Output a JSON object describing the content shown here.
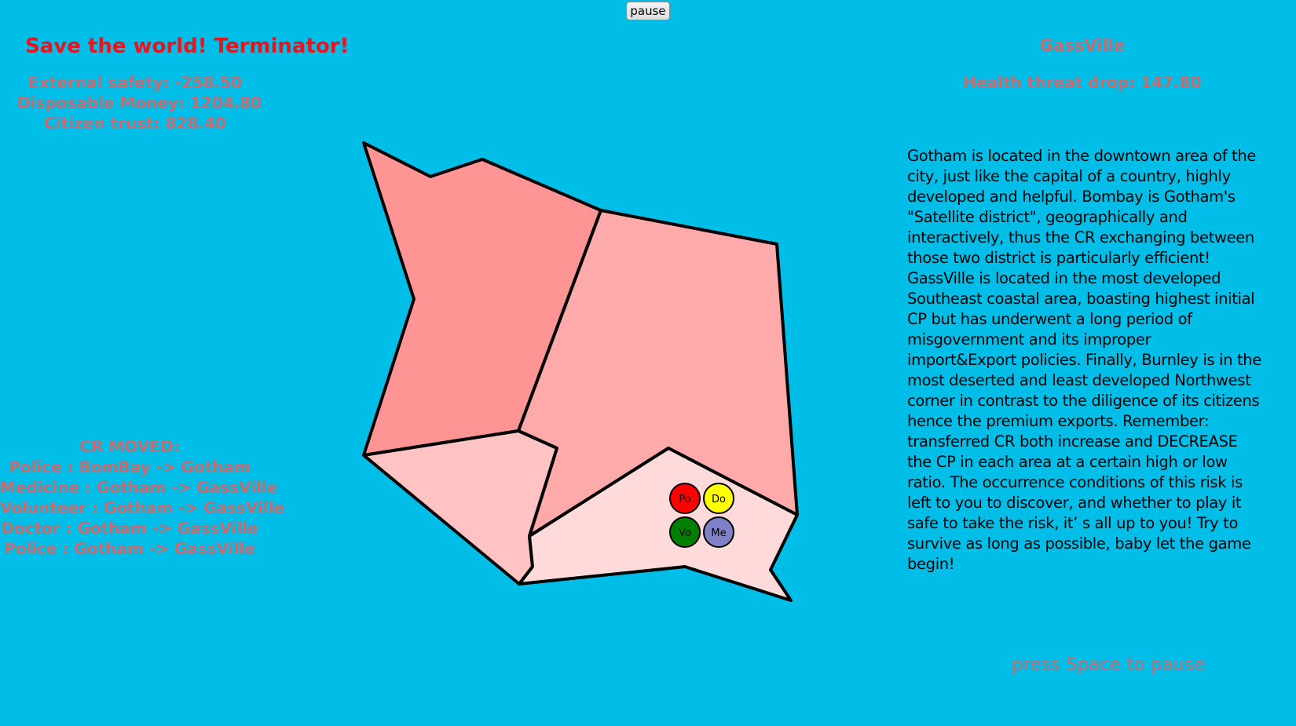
{
  "pause_button": "pause",
  "title": "Save the world! Terminator!",
  "stats": {
    "external_safety": "External safety: -258.50",
    "disposable_money": "Disposable Money: 1204.80",
    "citizen_trust": "Citizen trust: 828.40"
  },
  "selected_region": {
    "name": "GassVille",
    "health_threat": "Health threat drop: 147.80"
  },
  "cr_moved": {
    "title": "CR MOVED:",
    "items": [
      "Police : BomBay -> Gotham",
      "Medicine : Gotham -> GassVille",
      "Volunteer : Gotham -> GassVille",
      "Doctor : Gotham -> GassVille",
      "Police : Gotham -> GassVille"
    ]
  },
  "description": "Gotham is located in the downtown area of the city, just like the capital of a country, highly developed and helpful. Bombay is Gotham's \"Satellite district\", geographically and interactively, thus the CR exchanging between those two district is particularly efficient! GassVille is located in the most developed Southeast coastal area, boasting highest initial CP but has underwent a long period of misgovernment and its improper import&Export policies. Finally, Burnley is in the most deserted and least developed Northwest corner in contrast to the diligence of its citizens hence the premium exports. Remember: transferred CR both increase and DECREASE the CP in each area at a certain high or low ratio. The occurrence conditions of this risk is left to you to discover, and whether to play it safe to take the risk, it’ s all up to you! Try to survive as long as possible, baby let the game begin!",
  "hint": "press Space to pause",
  "colors": {
    "background": "#00bee8",
    "title": "#e8141e",
    "stat_text": "#c96a6e",
    "region_northwest": "#ff9494",
    "region_east": "#ffaaaa",
    "region_southwest": "#ffc3c3",
    "region_southeast": "#ffdada"
  },
  "resources": [
    {
      "label": "Po",
      "color": "#ff0000"
    },
    {
      "label": "Do",
      "color": "#ffff00"
    },
    {
      "label": "Vo",
      "color": "#008000"
    },
    {
      "label": "Me",
      "color": "#8080c8"
    }
  ]
}
